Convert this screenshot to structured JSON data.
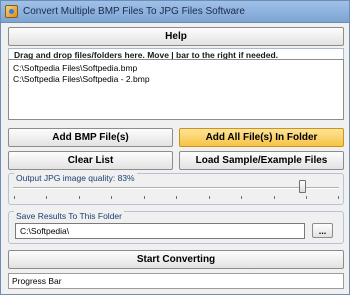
{
  "window": {
    "title": "Convert Multiple BMP Files To JPG Files Software"
  },
  "help": {
    "label": "Help"
  },
  "files": {
    "instruction": "Drag and drop files/folders here. Move | bar to the right if needed.",
    "items": [
      "C:\\Softpedia Files\\Softpedia.bmp",
      "C:\\Softpedia Files\\Softpedia - 2.bmp"
    ]
  },
  "buttons": {
    "add_files": "Add BMP File(s)",
    "add_folder": "Add All File(s) In Folder",
    "clear_list": "Clear List",
    "load_sample": "Load Sample/Example Files",
    "browse": "...",
    "start": "Start Converting"
  },
  "quality": {
    "label": "Output JPG image quality: 83%",
    "value": 83
  },
  "output": {
    "label": "Save Results To This Folder",
    "path": "C:\\Softpedia\\"
  },
  "progress": {
    "label": "Progress Bar",
    "value": 0
  },
  "colors": {
    "accent": "#f6c445",
    "title_bar": "#7ea4d4"
  }
}
